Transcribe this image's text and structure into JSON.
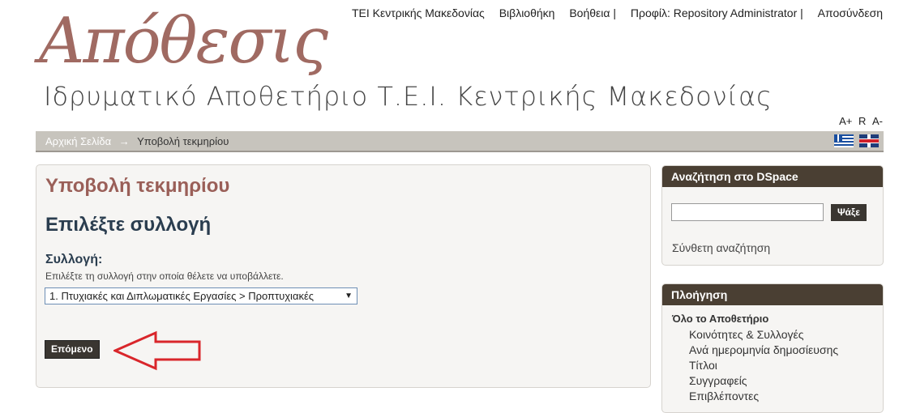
{
  "topnav": {
    "items": [
      "ΤΕΙ Κεντρικής Μακεδονίας",
      "Βιβλιοθήκη",
      "Βοήθεια |",
      "Προφίλ: Repository Administrator |",
      "Αποσύνδεση"
    ]
  },
  "logo": {
    "script": "Απόθεσις",
    "subtitle": "Ιδρυματικό Αποθετήριο Τ.Ε.Ι. Κεντρικής Μακεδονίας"
  },
  "fontsize": {
    "increase": "A+",
    "reset": "R",
    "decrease": "A-"
  },
  "breadcrumb": {
    "home": "Αρχική Σελίδα",
    "separator": "→",
    "current": "Υποβολή τεκμηρίου"
  },
  "main": {
    "title": "Υποβολή τεκμηρίου",
    "heading": "Επιλέξτε συλλογή",
    "field_label": "Συλλογή:",
    "field_help": "Επιλέξτε τη συλλογή στην οποία θέλετε να υποβάλλετε.",
    "selected_collection": "1. Πτυχιακές και Διπλωματικές Εργασίες > Προπτυχιακές",
    "next_label": "Επόμενο"
  },
  "search": {
    "heading": "Αναζήτηση στο DSpace",
    "button": "Ψάξε",
    "input_value": "",
    "advanced": "Σύνθετη αναζήτηση"
  },
  "navigation": {
    "heading": "Πλοήγηση",
    "group": "Όλο το Αποθετήριο",
    "items": [
      "Κοινότητες & Συλλογές",
      "Ανά ημερομηνία δημοσίευσης",
      "Τίτλοι",
      "Συγγραφείς",
      "Επιβλέποντες"
    ]
  },
  "colors": {
    "accent_title": "#9a5f58",
    "heading": "#2a3d4f",
    "sidebar_header": "#4a3f33",
    "annotation_arrow": "#d9262b"
  }
}
